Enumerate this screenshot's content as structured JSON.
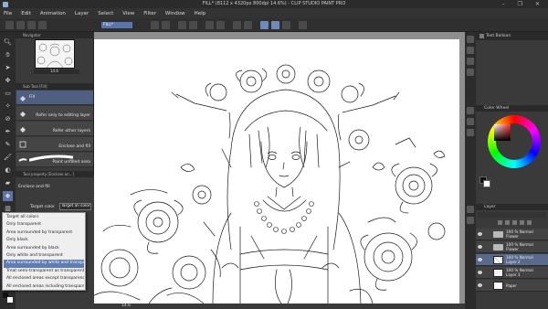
{
  "window": {
    "title": "FILL* (8112 x 4320px 800dpi 14.6%)  - CLIP STUDIO PAINT PRO",
    "controls": "–  ❐  ✕"
  },
  "menu": [
    "File",
    "Edit",
    "Animation",
    "Layer",
    "Select",
    "View",
    "Filter",
    "Window",
    "Help"
  ],
  "document_tab": "FILL*",
  "navigator": {
    "title": "Navigator",
    "zoom": "14.6"
  },
  "subtool": {
    "title": "Sub Tool [Fill]",
    "items": [
      {
        "label": "Fill",
        "selected": true
      },
      {
        "label": "Refer only to editing layer",
        "selected": false
      },
      {
        "label": "Refer other layers",
        "selected": false
      },
      {
        "label": "Enclose and fill",
        "selected": false
      },
      {
        "label": "Paint unfilled area",
        "selected": false
      }
    ]
  },
  "tool_property": {
    "title": "Tool property [Enclose an...]",
    "subtitle": "Enclose and fill",
    "target_label": "Target color",
    "target_value": "Target all colors"
  },
  "dropdown": {
    "highlighted_index": 6,
    "options": [
      "Target all colors",
      "Only transparent",
      "Area surrounded by transparent",
      "Only black",
      "Area surrounded by black",
      "Only white and transparent",
      "Area surrounded by white and transparent",
      "Treat semi-transparent as transparent",
      "All enclosed areas except transparency",
      "All enclosed areas including transparency"
    ]
  },
  "status": {
    "zoom": "14.6"
  },
  "right_panel": {
    "tool_title": "Text Balloon",
    "color_wheel_title": "Color Wheel",
    "layer_title": "Layer",
    "layers": [
      {
        "name": "100 % Normal\nFlower",
        "type": "folder",
        "selected": false
      },
      {
        "name": "100 % Normal\nFlower",
        "type": "folder",
        "selected": false
      },
      {
        "name": "100 % Normal\nLayer 2",
        "type": "layer",
        "selected": true
      },
      {
        "name": "100 % Normal\nLayer 1",
        "type": "layer",
        "selected": false
      },
      {
        "name": "Paper",
        "type": "paper",
        "selected": false
      }
    ]
  }
}
